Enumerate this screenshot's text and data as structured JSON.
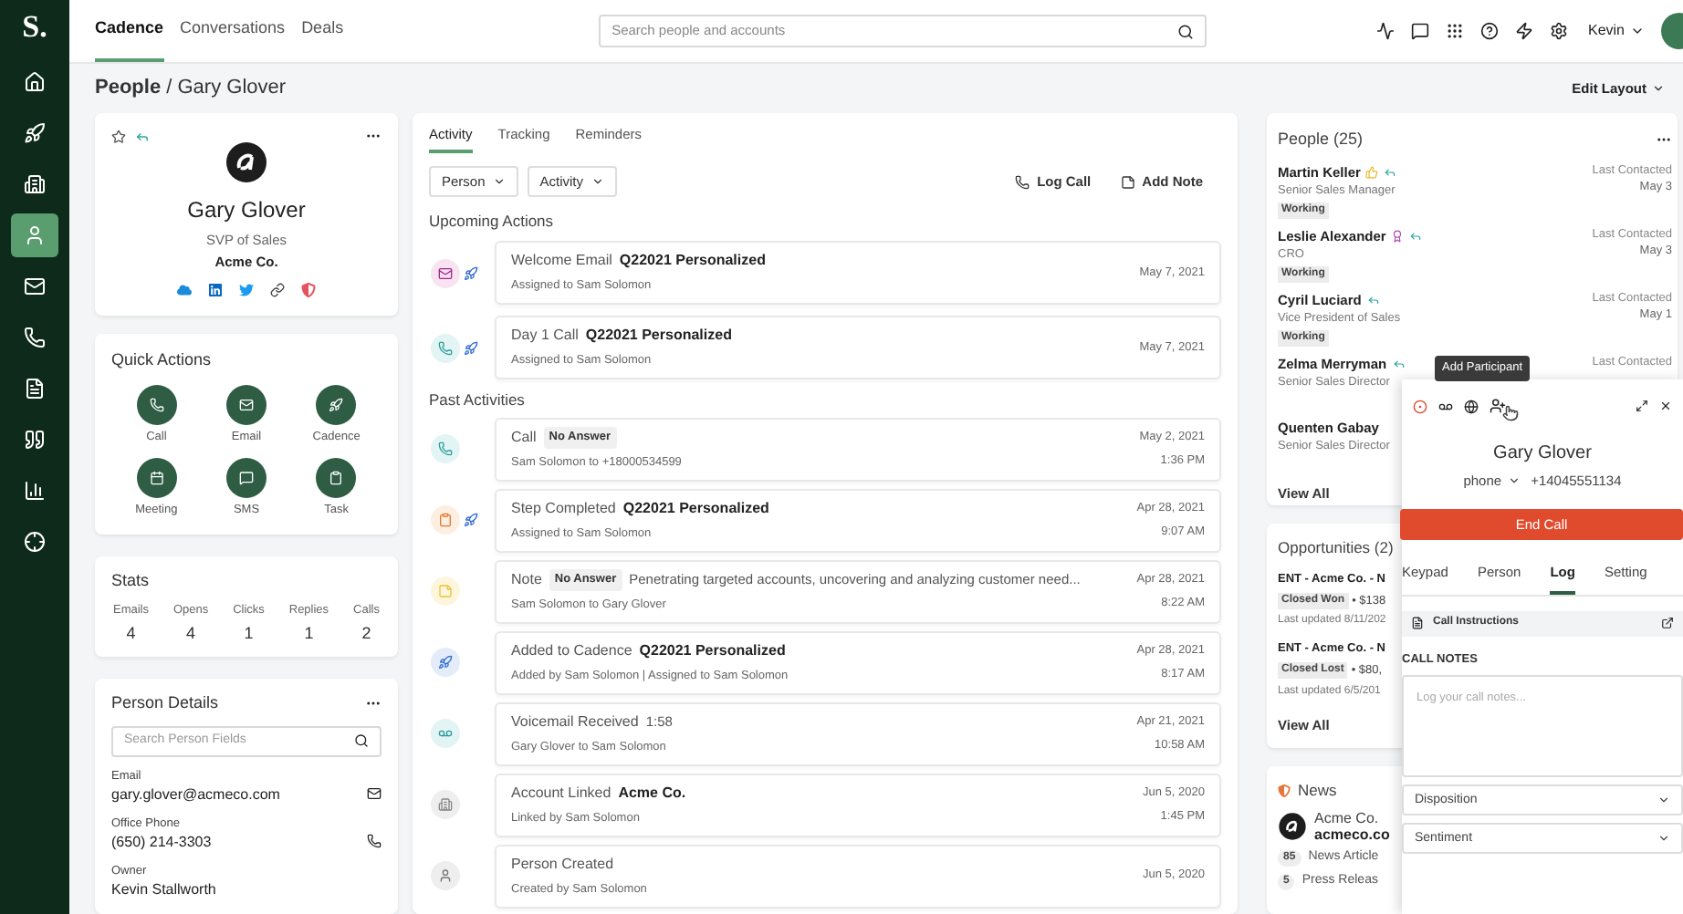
{
  "sidebar": {
    "logo": "S.",
    "items": [
      {
        "selected": false
      },
      {
        "selected": false
      },
      {
        "selected": false
      },
      {
        "selected": true
      },
      {
        "selected": false
      },
      {
        "selected": false
      },
      {
        "selected": false
      },
      {
        "selected": false
      },
      {
        "selected": false
      },
      {
        "selected": false
      }
    ]
  },
  "nav_tabs": [
    {
      "label": "Cadence",
      "selected": true
    },
    {
      "label": "Conversations",
      "selected": false
    },
    {
      "label": "Deals",
      "selected": false
    }
  ],
  "search": {
    "placeholder": "Search people and accounts"
  },
  "user": {
    "name": "Kevin"
  },
  "breadcrumb": "**People** / Gary Glover",
  "edit_layout": "Edit Layout",
  "person_card": {
    "name": "Gary Glover",
    "title": "SVP of Sales",
    "company": "Acme Co.",
    "starred": false
  },
  "quick_actions": {
    "title": "Quick Actions",
    "actions": [
      {
        "kind": "call",
        "label": "Call"
      },
      {
        "kind": "email",
        "label": "Email"
      },
      {
        "kind": "cadence",
        "label": "Cadence"
      },
      {
        "kind": "meeting",
        "label": "Meeting"
      },
      {
        "kind": "sms",
        "label": "SMS"
      },
      {
        "kind": "task",
        "label": "Task"
      }
    ]
  },
  "stats": {
    "title": "Stats",
    "items": [
      {
        "label": "Emails",
        "value": "4"
      },
      {
        "label": "Opens",
        "value": "4"
      },
      {
        "label": "Clicks",
        "value": "1"
      },
      {
        "label": "Replies",
        "value": "1"
      },
      {
        "label": "Calls",
        "value": "2"
      }
    ]
  },
  "person_details": {
    "title": "Person Details",
    "search_placeholder": "Search Person Fields",
    "fields": [
      {
        "kind": "email",
        "label": "Email",
        "value": "gary.glover@acmeco.com"
      },
      {
        "kind": "phone",
        "label": "Office Phone",
        "value": "(650) 214-3303"
      },
      {
        "kind": "text",
        "label": "Owner",
        "value": "Kevin Stallworth"
      }
    ]
  },
  "activity": {
    "tabs": [
      {
        "label": "Activity",
        "selected": true
      },
      {
        "label": "Tracking",
        "selected": false
      },
      {
        "label": "Reminders",
        "selected": false
      }
    ],
    "filters": [
      "Person",
      "Activity"
    ],
    "actions": [
      {
        "kind": "call",
        "label": "Log Call"
      },
      {
        "kind": "note",
        "label": "Add Note"
      }
    ],
    "upcoming_title": "Upcoming Actions",
    "upcoming": [
      {
        "kind": "email",
        "label": "Welcome Email",
        "emphasis": "Q22021 Personalized",
        "subtitle": "Assigned to Sam Solomon",
        "date": "May 7, 2021",
        "cadence": true
      },
      {
        "kind": "call",
        "label": "Day 1 Call",
        "emphasis": "Q22021 Personalized",
        "subtitle": "Assigned to Sam Solomon",
        "date": "May 7, 2021",
        "cadence": true
      }
    ],
    "past_title": "Past Activities",
    "past": [
      {
        "kind": "call",
        "label": "Call",
        "badge": "No Answer",
        "subtitle": "Sam Solomon to +18000534599",
        "date": "May 2, 2021",
        "time": "1:36 PM",
        "cadence": false
      },
      {
        "kind": "step",
        "label": "Step Completed",
        "emphasis": "Q22021 Personalized",
        "subtitle": "Assigned to Sam Solomon",
        "date": "Apr 28, 2021",
        "time": "9:07 AM",
        "cadence": true
      },
      {
        "kind": "note",
        "label": "Note",
        "badge": "No Answer",
        "detail": "Penetrating targeted accounts, uncovering and analyzing customer need...",
        "subtitle": "Sam Solomon to Gary Glover",
        "date": "Apr 28, 2021",
        "time": "8:22 AM",
        "cadence": false
      },
      {
        "kind": "cadence",
        "label": "Added to Cadence",
        "emphasis": "Q22021 Personalized",
        "subtitle": "Added by Sam Solomon | Assigned to Sam Solomon",
        "date": "Apr 28, 2021",
        "time": "8:17 AM",
        "cadence": false
      },
      {
        "kind": "voicemail",
        "label": "Voicemail Received",
        "detail": "1:58",
        "subtitle": "Gary Glover to Sam Solomon",
        "date": "Apr 21, 2021",
        "time": "10:58 AM",
        "cadence": false
      },
      {
        "kind": "account",
        "label": "Account Linked",
        "emphasis": "Acme Co.",
        "subtitle": "Linked by Sam Solomon",
        "date": "Jun 5, 2020",
        "time": "1:45 PM",
        "cadence": false
      },
      {
        "kind": "person",
        "label": "Person Created",
        "subtitle": "Created by Sam Solomon",
        "date": "Jun 5, 2020",
        "cadence": false
      }
    ]
  },
  "people": {
    "title": "People (25)",
    "items": [
      {
        "name": "Martin Keller",
        "kind": "thumbs_up",
        "replied": true,
        "title": "Senior Sales Manager",
        "status": "Working",
        "contacted_label": "Last Contacted",
        "contacted": "May 3"
      },
      {
        "name": "Leslie Alexander",
        "kind": "ribbon",
        "replied": true,
        "title": "CRO",
        "status": "Working",
        "contacted_label": "Last Contacted",
        "contacted": "May 3"
      },
      {
        "name": "Cyril Luciard",
        "kind": "plain",
        "replied": true,
        "title": "Vice President of Sales",
        "status": "Working",
        "contacted_label": "Last Contacted",
        "contacted": "May 1"
      },
      {
        "name": "Zelma Merryman",
        "kind": "plain",
        "replied": true,
        "title": "Senior Sales Director",
        "contacted_label": "Last Contacted"
      },
      {
        "name": "Quenten Gabay",
        "kind": "plain",
        "replied": false,
        "title": "Senior Sales Director"
      }
    ],
    "view_all": "View All"
  },
  "opportunities": {
    "title": "Opportunities (2)",
    "items": [
      {
        "name": "ENT - Acme Co. - N",
        "stage": "Closed Won",
        "amount": "• $138",
        "updated": "Last updated 8/11/202"
      },
      {
        "name": "ENT - Acme Co. - N",
        "stage": "Closed Lost",
        "amount": "• $80,",
        "updated": "Last updated 6/5/201"
      }
    ],
    "view_all": "View All"
  },
  "news": {
    "title": "News",
    "company": "Acme Co.",
    "domain": "acmeco.co",
    "counts": [
      {
        "count": "85",
        "label": "News Article"
      },
      {
        "count": "5",
        "label": "Press Releas"
      }
    ]
  },
  "call_panel": {
    "tooltip": "Add Participant",
    "contact": "Gary Glover",
    "line": "phone",
    "number": "+14045551134",
    "end_call": "End Call",
    "tabs": [
      {
        "label": "Keypad",
        "selected": false
      },
      {
        "label": "Person",
        "selected": false
      },
      {
        "label": "Log",
        "selected": true
      },
      {
        "label": "Setting",
        "selected": false
      }
    ],
    "instructions": "Call Instructions",
    "notes_label": "CALL NOTES",
    "notes_placeholder": "Log your call notes...",
    "selects": [
      "Disposition",
      "Sentiment"
    ]
  }
}
